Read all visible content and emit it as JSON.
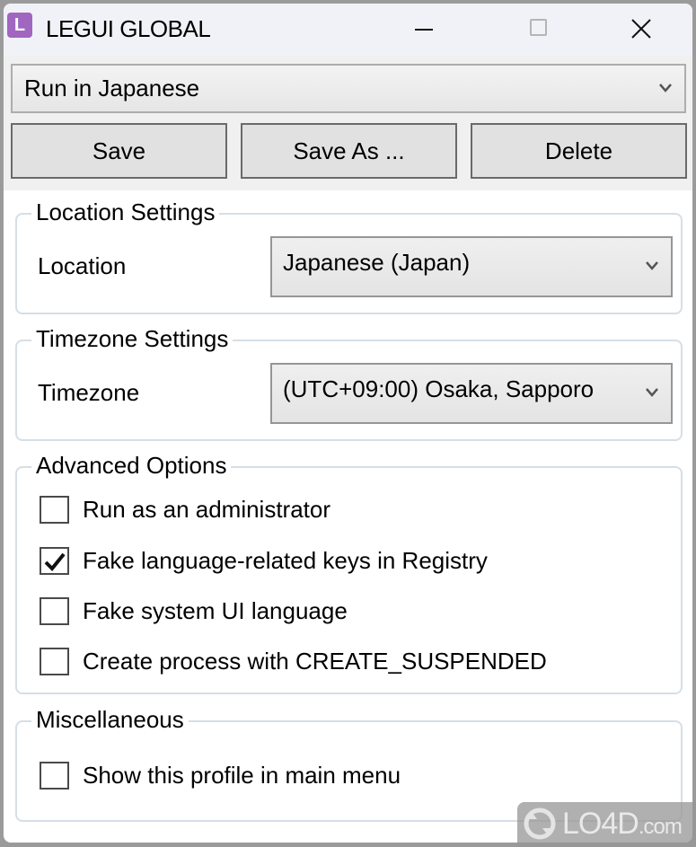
{
  "window": {
    "title": "LEGUI GLOBAL",
    "app_icon_letter": "L",
    "accent_color": "#a066c0"
  },
  "toolbar": {
    "profile_select_value": "Run in Japanese",
    "save_label": "Save",
    "save_as_label": "Save As ...",
    "delete_label": "Delete"
  },
  "location_settings": {
    "legend": "Location Settings",
    "label": "Location",
    "value": "Japanese (Japan)"
  },
  "timezone_settings": {
    "legend": "Timezone Settings",
    "label": "Timezone",
    "value": "(UTC+09:00) Osaka, Sapporo"
  },
  "advanced_options": {
    "legend": "Advanced Options",
    "items": [
      {
        "label": "Run as an administrator",
        "checked": false
      },
      {
        "label": "Fake language-related keys in Registry",
        "checked": true
      },
      {
        "label": "Fake system UI language",
        "checked": false
      },
      {
        "label": "Create process with CREATE_SUSPENDED",
        "checked": false
      }
    ]
  },
  "miscellaneous": {
    "legend": "Miscellaneous",
    "items": [
      {
        "label": "Show this profile in main menu",
        "checked": false
      }
    ]
  },
  "watermark": {
    "text": "LO4D",
    "suffix": ".com"
  }
}
